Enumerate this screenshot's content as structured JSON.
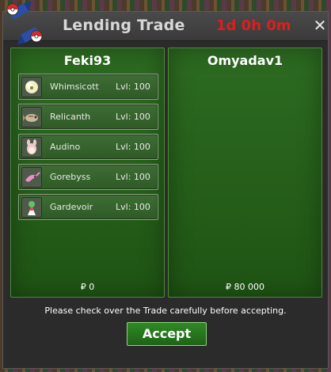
{
  "window": {
    "title": "Lending Trade",
    "timer": "1d 0h 0m",
    "close_label": "✕"
  },
  "left_trader": {
    "name": "Feki93",
    "pokemon": [
      {
        "name": "Whimsicott",
        "level": "Lvl: 100",
        "icon": "whimsicott-icon"
      },
      {
        "name": "Relicanth",
        "level": "Lvl: 100",
        "icon": "relicanth-icon"
      },
      {
        "name": "Audino",
        "level": "Lvl: 100",
        "icon": "audino-icon"
      },
      {
        "name": "Gorebyss",
        "level": "Lvl: 100",
        "icon": "gorebyss-icon"
      },
      {
        "name": "Gardevoir",
        "level": "Lvl: 100",
        "icon": "gardevoir-icon"
      }
    ],
    "money": "₽ 0"
  },
  "right_trader": {
    "name": "Omyadav1",
    "pokemon": [],
    "money": "₽ 80 000"
  },
  "footer": {
    "notice": "Please check over the Trade carefully before accepting.",
    "accept_label": "Accept"
  },
  "colors": {
    "timer": "#d9201e",
    "panel_green": "#2d6b21",
    "accept_green": "#2f8a24"
  }
}
